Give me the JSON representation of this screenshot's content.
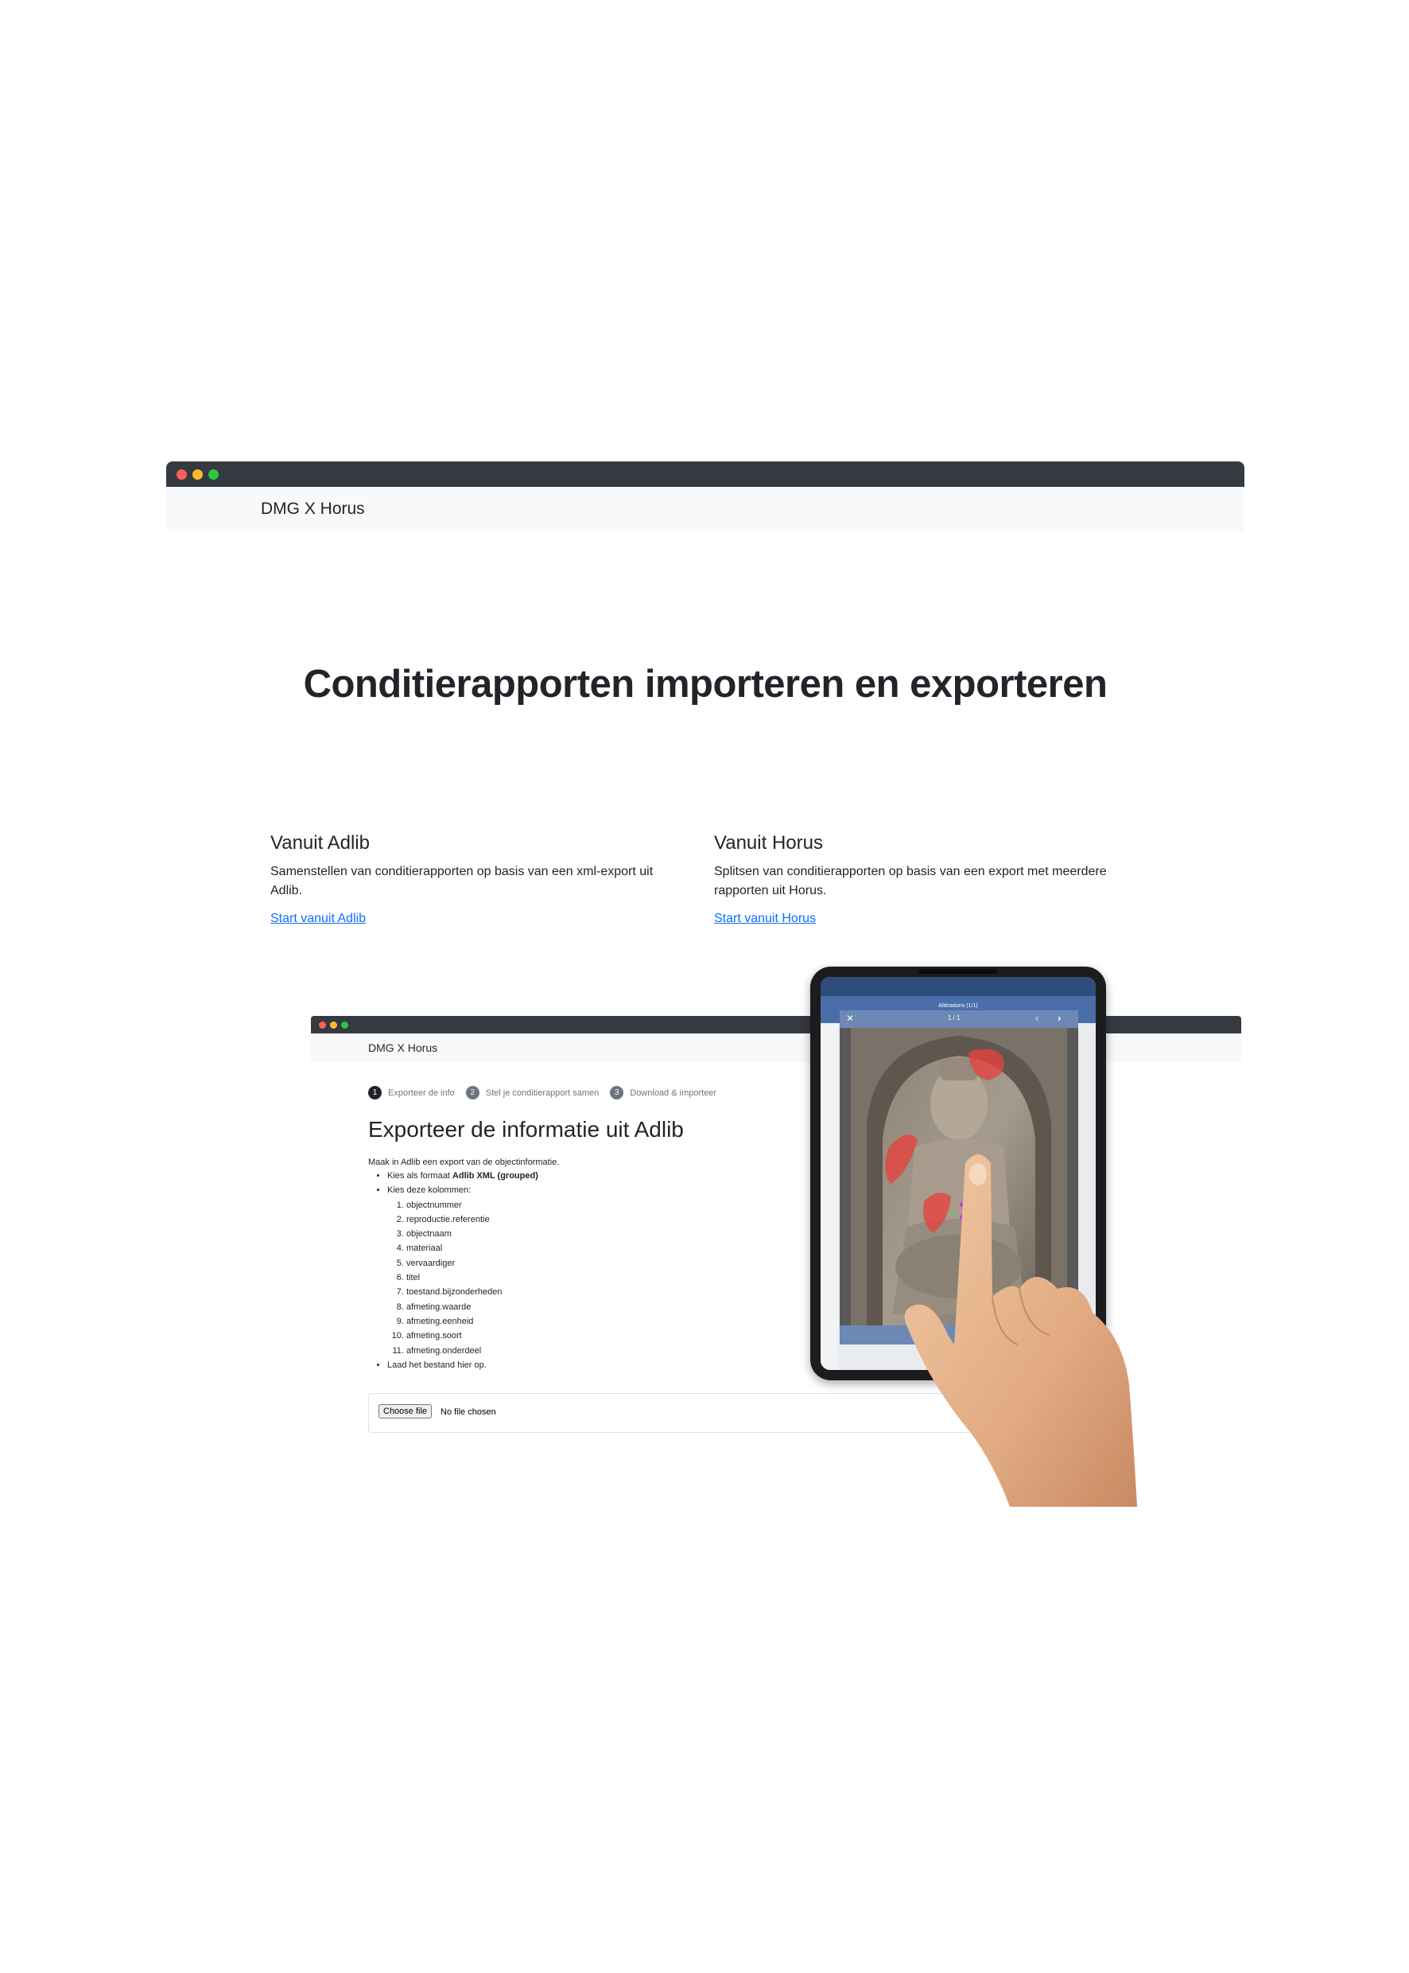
{
  "header": {
    "brand": "DMG X Horus"
  },
  "hero": {
    "title": "Conditierapporten importeren en exporteren"
  },
  "columns": [
    {
      "title": "Vanuit Adlib",
      "text": "Samenstellen van conditierapporten op basis van een xml-export uit Adlib.",
      "link": "Start vanuit Adlib"
    },
    {
      "title": "Vanuit Horus",
      "text": "Splitsen van conditierapporten op basis van een export met meerdere rapporten uit Horus.",
      "link": "Start vanuit Horus"
    }
  ],
  "inner": {
    "brand": "DMG X Horus",
    "steps": [
      {
        "num": "1",
        "label": "Exporteer de info"
      },
      {
        "num": "2",
        "label": "Stel je conditierapport samen"
      },
      {
        "num": "3",
        "label": "Download & importeer"
      }
    ],
    "heading": "Exporteer de informatie uit Adlib",
    "lead": "Maak in Adlib een export van de objectinformatie.",
    "bullet1_prefix": "Kies als formaat ",
    "bullet1_bold": "Adlib XML (grouped)",
    "bullet2": "Kies deze kolommen:",
    "columns_list": [
      "objectnummer",
      "reproductie.referentie",
      "objectnaam",
      "materiaal",
      "vervaardiger",
      "titel",
      "toestand.bijzonderheden",
      "afmeting.waarde",
      "afmeting.eenheid",
      "afmeting.soort",
      "afmeting.onderdeel"
    ],
    "bullet3": "Laad het bestand hier op.",
    "file_button": "Choose file",
    "file_status": "No file chosen"
  },
  "tablet": {
    "app_title": "Altérations (1/1)",
    "viewer_counter": "1 / 1"
  },
  "colors": {
    "titlebar": "#343a40",
    "link": "#0d6efd",
    "annotation": "#e8413c",
    "app_bar": "#4a6ea9"
  },
  "icons": [
    "close-icon",
    "chevron-left-icon",
    "chevron-right-icon"
  ]
}
